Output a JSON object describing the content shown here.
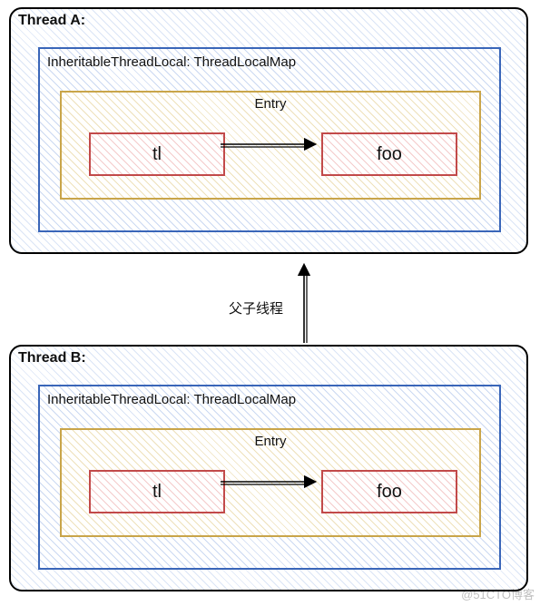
{
  "threadA": {
    "title": "Thread A:",
    "map": {
      "title": "InheritableThreadLocal: ThreadLocalMap",
      "entry": {
        "title": "Entry",
        "key": "tl",
        "value": "foo"
      }
    }
  },
  "relation_label": "父子线程",
  "threadB": {
    "title": "Thread B:",
    "map": {
      "title": "InheritableThreadLocal: ThreadLocalMap",
      "entry": {
        "title": "Entry",
        "key": "tl",
        "value": "foo"
      }
    }
  },
  "watermark": "@51CTO博客"
}
